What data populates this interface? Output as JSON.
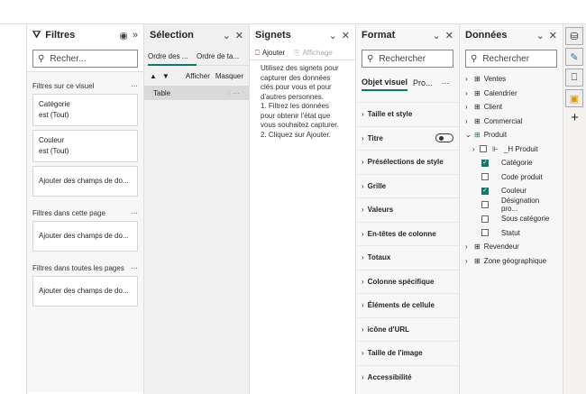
{
  "filters": {
    "title": "Filtres",
    "search_placeholder": "Recher...",
    "visual_section": "Filtres sur ce visuel",
    "cards": [
      {
        "field": "Catégorie",
        "state": "est (Tout)"
      },
      {
        "field": "Couleur",
        "state": "est (Tout)"
      }
    ],
    "add_fields": "Ajouter des champs de do...",
    "page_section": "Filtres dans cette page",
    "all_pages_section": "Filtres dans toutes les pages",
    "more": "···"
  },
  "selection": {
    "title": "Sélection",
    "tabs": [
      "Ordre des ...",
      "Ordre de ta..."
    ],
    "show": "Afficher",
    "hide": "Masquer",
    "items": [
      "Table"
    ]
  },
  "bookmarks": {
    "title": "Signets",
    "add": "Ajouter",
    "view": "Affichage",
    "help": [
      "Utilisez des signets pour capturer des données clés pour vous et pour d'autres personnes.",
      "1. Filtrez les données pour obtenir l'état que vous souhaitez capturer.",
      "2. Cliquez sur Ajouter."
    ]
  },
  "format": {
    "title": "Format",
    "search_placeholder": "Rechercher",
    "tabs": [
      "Objet visuel",
      "Pro..."
    ],
    "more": "···",
    "sections": [
      "Taille et style",
      "Titre",
      "Présélections de style",
      "Grille",
      "Valeurs",
      "En-têtes de colonne",
      "Totaux",
      "Colonne spécifique",
      "Éléments de cellule",
      "icône d'URL",
      "Taille de l'image",
      "Accessibilité"
    ]
  },
  "data": {
    "title": "Données",
    "search_placeholder": "Rechercher",
    "tables": [
      "Ventes",
      "Calendrier",
      "Client",
      "Commercial"
    ],
    "expanded": "Produit",
    "hierarchy": "_H Produit",
    "fields": [
      {
        "name": "Catégorie",
        "checked": true
      },
      {
        "name": "Code produit",
        "checked": false
      },
      {
        "name": "Couleur",
        "checked": true
      },
      {
        "name": "Désignation pro...",
        "checked": false
      },
      {
        "name": "Sous catégorie",
        "checked": false
      },
      {
        "name": "Statut",
        "checked": false
      }
    ],
    "tables_after": [
      "Revendeur",
      "Zone géographique"
    ]
  }
}
